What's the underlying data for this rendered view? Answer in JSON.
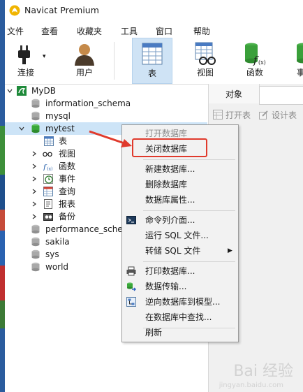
{
  "window": {
    "title": "Navicat Premium"
  },
  "menubar": {
    "items": [
      "文件",
      "查看",
      "收藏夹",
      "工具",
      "窗口",
      "帮助"
    ]
  },
  "toolbar": {
    "tools": [
      "连接",
      "用户",
      "表",
      "视图",
      "函数",
      "事"
    ],
    "selected": "表"
  },
  "tree": {
    "connection": "MyDB",
    "databases_before": [
      "information_schema",
      "mysql"
    ],
    "open_db": "mytest",
    "children": [
      "表",
      "视图",
      "函数",
      "事件",
      "查询",
      "报表",
      "备份"
    ],
    "databases_after": [
      "performance_schema",
      "sakila",
      "sys",
      "world"
    ]
  },
  "object_panel": {
    "tab": "对象",
    "open_table": "打开表",
    "design_table": "设计表"
  },
  "context_menu": {
    "items": [
      {
        "label": "打开数据库",
        "enabled": false,
        "icon": ""
      },
      {
        "label": "关闭数据库",
        "enabled": true,
        "icon": "",
        "highlighted": true
      },
      {
        "label": "新建数据库...",
        "enabled": true,
        "icon": ""
      },
      {
        "label": "删除数据库",
        "enabled": true,
        "icon": ""
      },
      {
        "label": "数据库属性...",
        "enabled": true,
        "icon": ""
      },
      {
        "label": "命令列介面...",
        "enabled": true,
        "icon": "console-icon"
      },
      {
        "label": "运行 SQL 文件...",
        "enabled": true,
        "icon": ""
      },
      {
        "label": "转储 SQL 文件",
        "enabled": true,
        "icon": "",
        "submenu": true
      },
      {
        "label": "打印数据库...",
        "enabled": true,
        "icon": "printer-icon"
      },
      {
        "label": "数据传输...",
        "enabled": true,
        "icon": "data-transfer-icon"
      },
      {
        "label": "逆向数据库到模型...",
        "enabled": true,
        "icon": "reverse-model-icon"
      },
      {
        "label": "在数据库中查找...",
        "enabled": true,
        "icon": ""
      },
      {
        "label": "刷新",
        "enabled": true,
        "icon": ""
      }
    ]
  },
  "watermark": {
    "text": "Bai 经验",
    "sub": "jingyan.baidu.com"
  },
  "colors": {
    "selection": "#cde4f7",
    "highlight_box": "#e03a2c",
    "db_icon_green": "#3aa83a"
  }
}
